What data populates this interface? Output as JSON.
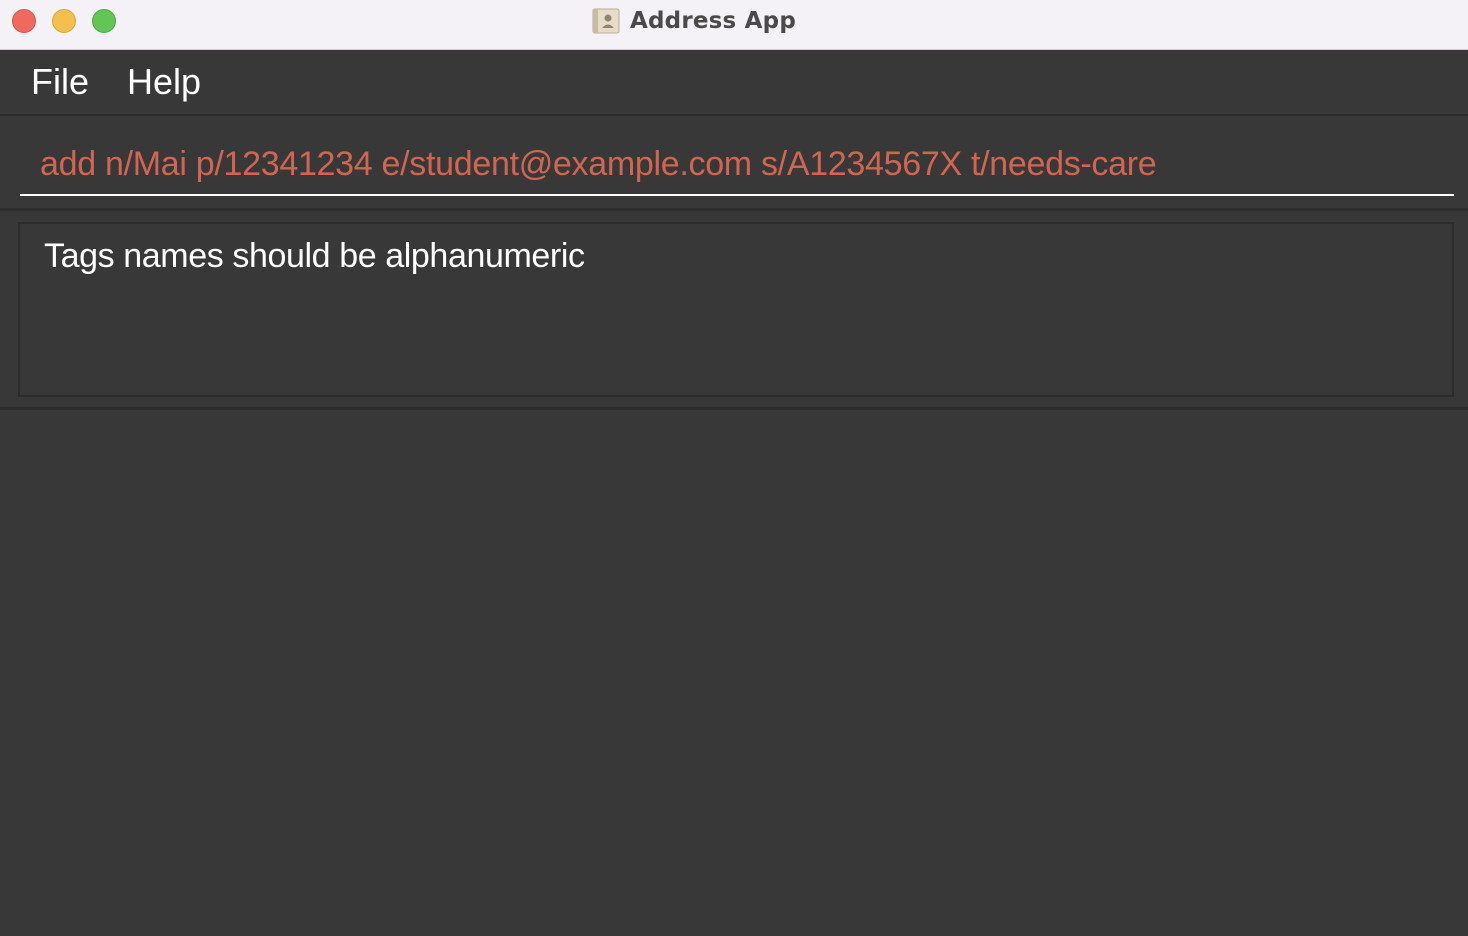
{
  "window": {
    "title": "Address App",
    "icon": "address-book-icon",
    "controls": [
      "close",
      "minimize",
      "maximize"
    ]
  },
  "menu": {
    "items": [
      {
        "label": "File"
      },
      {
        "label": "Help"
      }
    ]
  },
  "command_box": {
    "value": "add n/Mai p/12341234 e/student@example.com s/A1234567X t/needs-care",
    "text_color": "#d06651"
  },
  "result_display": {
    "message": "Tags names should be alphanumeric"
  },
  "colors": {
    "background": "#383838",
    "titlebar": "#f4f1f7",
    "error_text": "#d06651",
    "text": "#ffffff"
  }
}
